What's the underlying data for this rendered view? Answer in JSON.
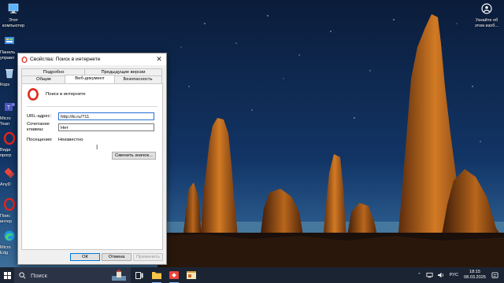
{
  "desktop": {
    "icons": [
      {
        "label_lines": [
          "Этот",
          "компьютер"
        ],
        "icon": "monitor-icon"
      },
      {
        "label_lines": [
          "Панель",
          "управл"
        ],
        "icon": "control-panel-icon"
      },
      {
        "label_lines": [
          "Корз"
        ],
        "icon": "recycle-bin-icon"
      },
      {
        "label_lines": [
          "Micro",
          "Tean"
        ],
        "icon": "teams-icon"
      },
      {
        "label_lines": [
          "Вида",
          "прогр"
        ],
        "icon": "opera-icon"
      },
      {
        "label_lines": [
          "AnyD"
        ],
        "icon": "anydesk-icon"
      },
      {
        "label_lines": [
          "Поис",
          "интер"
        ],
        "icon": "opera-search-icon"
      },
      {
        "label_lines": [
          "Micro",
          "Edg"
        ],
        "icon": "edge-icon"
      }
    ],
    "right_icon": {
      "label_lines": [
        "Узнайте об",
        "этом изоб..."
      ],
      "icon": "learn-about-picture-icon"
    }
  },
  "dialog": {
    "title": "Свойства: Поиск в интернете",
    "tabs_row1": [
      "Подробно",
      "Предыдущие версии"
    ],
    "tabs_row2": [
      "Общие",
      "Веб-документ",
      "Безопасность"
    ],
    "active_tab": "Веб-документ",
    "shortcut_name": "Поиск в интернете",
    "fields": {
      "url_label": "URL-адрес:",
      "url_value": "http://ki.ru/?11",
      "hotkey_label_lines": [
        "Сочетание",
        "клавиш:"
      ],
      "hotkey_value": "Нет",
      "visits_label": "Посещения:",
      "visits_value": "Неизвестно"
    },
    "change_icon_button": "Сменить значок...",
    "buttons": {
      "ok": "ОК",
      "cancel": "Отмена",
      "apply": "Применить"
    }
  },
  "taskbar": {
    "search_placeholder": "Поиск",
    "language": "РУС",
    "time": "18:15",
    "date": "08.03.2025"
  },
  "colors": {
    "accent": "#0078d7",
    "taskbar": "#1b2433",
    "opera_red": "#e0261c"
  }
}
